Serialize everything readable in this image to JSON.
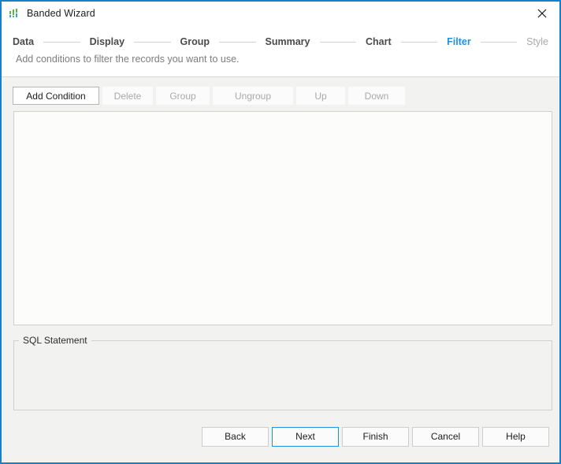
{
  "window": {
    "title": "Banded Wizard",
    "icon": "bar-chart-icon",
    "close_label": "✕",
    "accent_color": "#1480ce"
  },
  "steps": {
    "items": [
      {
        "label": "Data",
        "state": "done"
      },
      {
        "label": "Display",
        "state": "done"
      },
      {
        "label": "Group",
        "state": "done"
      },
      {
        "label": "Summary",
        "state": "done"
      },
      {
        "label": "Chart",
        "state": "done"
      },
      {
        "label": "Filter",
        "state": "active"
      },
      {
        "label": "Style",
        "state": "disabled"
      }
    ],
    "active_color": "#1e90e8",
    "done_color": "#4a4a4a",
    "disabled_color": "#a8a8a8"
  },
  "subtitle": "Add conditions to filter the records you want to use.",
  "toolbar": {
    "add_condition": "Add Condition",
    "delete": "Delete",
    "group": "Group",
    "ungroup": "Ungroup",
    "up": "Up",
    "down": "Down"
  },
  "conditions": {
    "items": []
  },
  "sql": {
    "legend": "SQL Statement",
    "value": ""
  },
  "footer": {
    "back": "Back",
    "next": "Next",
    "finish": "Finish",
    "cancel": "Cancel",
    "help": "Help"
  }
}
